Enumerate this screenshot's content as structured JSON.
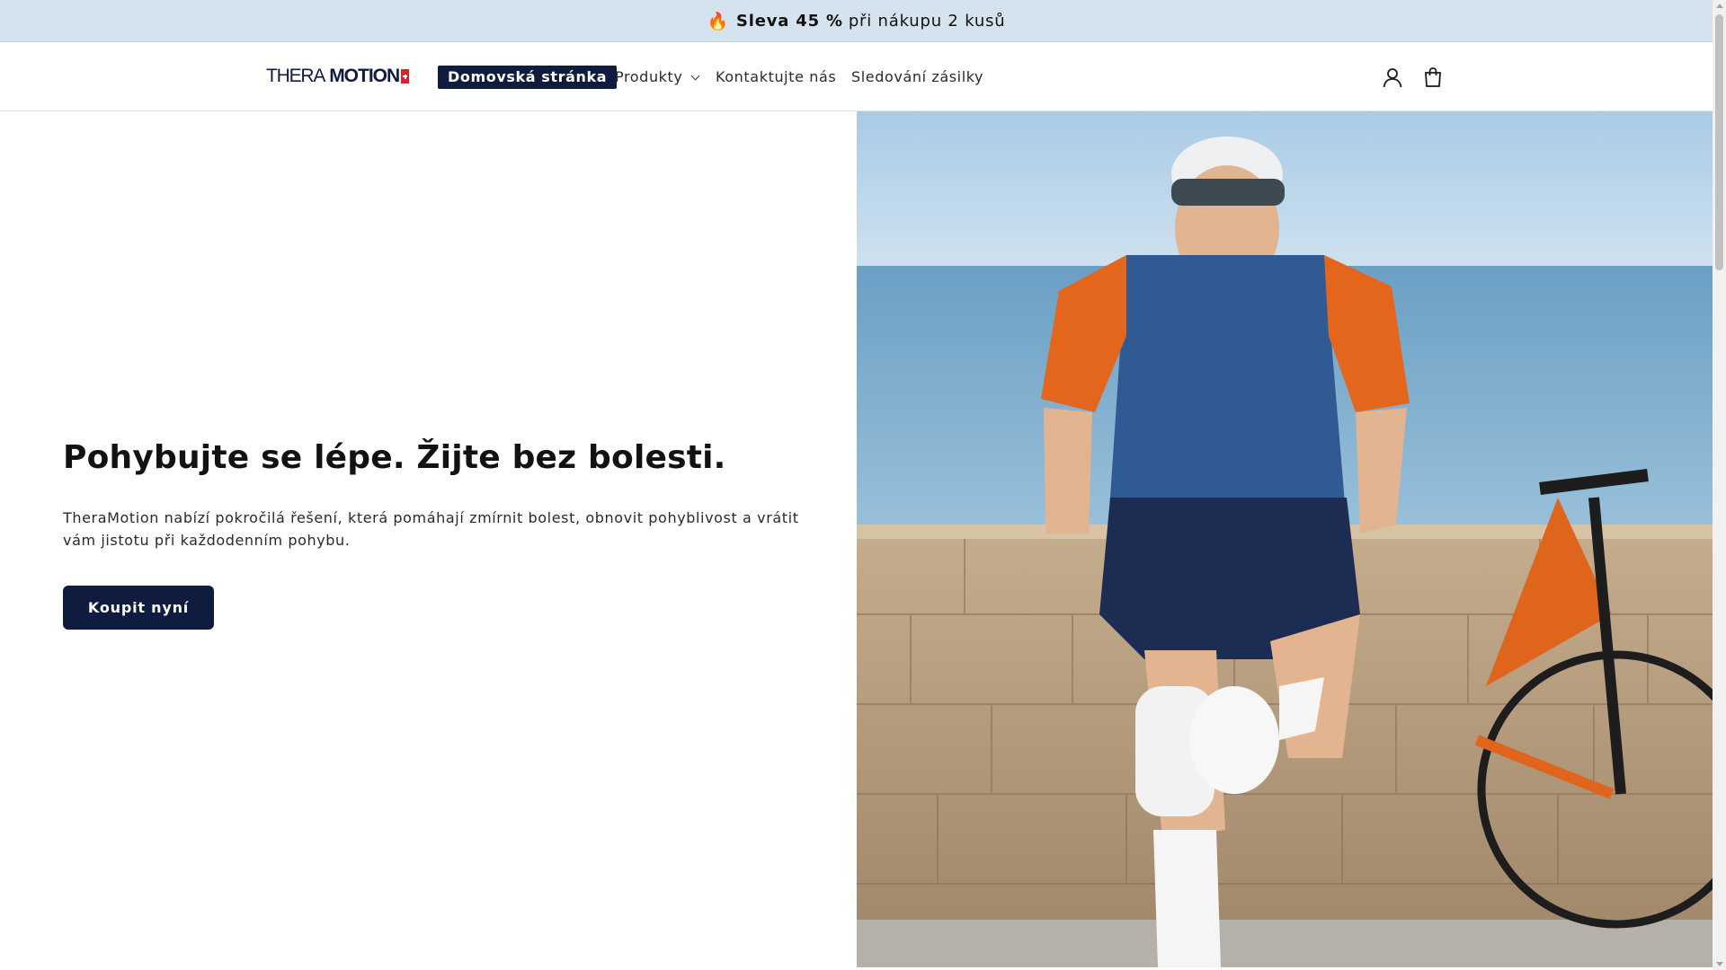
{
  "announcement": {
    "icon": "fire-icon",
    "emoji": "🔥",
    "bold": "Sleva 45 %",
    "rest": "při nákupu 2 kusů"
  },
  "header": {
    "logo_part1": "THERA",
    "logo_part2": "MOTION",
    "nav": {
      "home": "Domovská stránka",
      "products": "Produkty",
      "contact": "Kontaktujte nás",
      "tracking": "Sledování zásilky"
    },
    "icons": [
      "account-icon",
      "cart-icon"
    ]
  },
  "hero": {
    "title": "Pohybujte se lépe. Žijte bez bolesti.",
    "subtitle": "TheraMotion nabízí pokročilá řešení, která pomáhají zmírnit bolest, obnovit pohyblivost a vrátit vám jistotu při každodenním pohybu.",
    "cta": "Koupit nyní"
  },
  "colors": {
    "brand_navy": "#0f1c3f",
    "announcement_bg": "#d5e3ee",
    "flag_red": "#d6232d"
  }
}
